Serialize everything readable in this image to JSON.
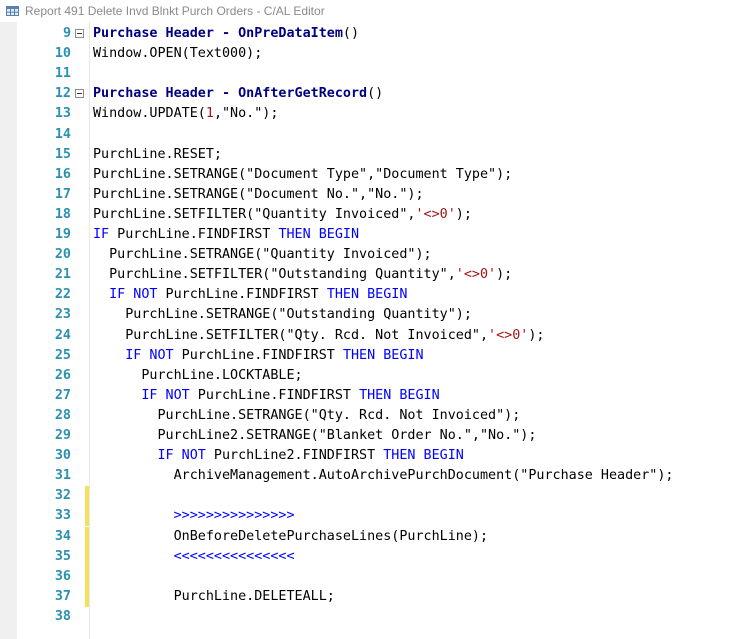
{
  "window": {
    "title": "Report 491 Delete Invd Blnkt Purch Orders - C/AL Editor",
    "icon": "table-grid-icon"
  },
  "editor": {
    "lines": [
      {
        "n": "9",
        "fold": true,
        "changed": false,
        "indent": 0,
        "tokens": [
          {
            "t": "Purchase Header - OnPreDataItem",
            "c": "navy bold"
          },
          {
            "t": "()",
            "c": ""
          }
        ]
      },
      {
        "n": "10",
        "fold": false,
        "changed": false,
        "indent": 0,
        "tokens": [
          {
            "t": "Window.OPEN(Text000);",
            "c": ""
          }
        ]
      },
      {
        "n": "11",
        "fold": false,
        "changed": false,
        "indent": 0,
        "tokens": []
      },
      {
        "n": "12",
        "fold": true,
        "changed": false,
        "indent": 0,
        "tokens": [
          {
            "t": "Purchase Header - OnAfterGetRecord",
            "c": "navy bold"
          },
          {
            "t": "()",
            "c": ""
          }
        ]
      },
      {
        "n": "13",
        "fold": false,
        "changed": false,
        "indent": 0,
        "tokens": [
          {
            "t": "Window.UPDATE(",
            "c": ""
          },
          {
            "t": "1",
            "c": "str"
          },
          {
            "t": ",\"No.\");",
            "c": ""
          }
        ]
      },
      {
        "n": "14",
        "fold": false,
        "changed": false,
        "indent": 0,
        "tokens": []
      },
      {
        "n": "15",
        "fold": false,
        "changed": false,
        "indent": 0,
        "tokens": [
          {
            "t": "PurchLine.RESET;",
            "c": ""
          }
        ]
      },
      {
        "n": "16",
        "fold": false,
        "changed": false,
        "indent": 0,
        "tokens": [
          {
            "t": "PurchLine.SETRANGE(\"Document Type\",\"Document Type\");",
            "c": ""
          }
        ]
      },
      {
        "n": "17",
        "fold": false,
        "changed": false,
        "indent": 0,
        "tokens": [
          {
            "t": "PurchLine.SETRANGE(\"Document No.\",\"No.\");",
            "c": ""
          }
        ]
      },
      {
        "n": "18",
        "fold": false,
        "changed": false,
        "indent": 0,
        "tokens": [
          {
            "t": "PurchLine.SETFILTER(\"Quantity Invoiced\",",
            "c": ""
          },
          {
            "t": "'<>0'",
            "c": "str"
          },
          {
            "t": ");",
            "c": ""
          }
        ]
      },
      {
        "n": "19",
        "fold": false,
        "changed": false,
        "indent": 0,
        "tokens": [
          {
            "t": "IF",
            "c": "kw"
          },
          {
            "t": " PurchLine.FINDFIRST ",
            "c": ""
          },
          {
            "t": "THEN BEGIN",
            "c": "kw"
          }
        ]
      },
      {
        "n": "20",
        "fold": false,
        "changed": false,
        "indent": 2,
        "tokens": [
          {
            "t": "PurchLine.SETRANGE(\"Quantity Invoiced\");",
            "c": ""
          }
        ]
      },
      {
        "n": "21",
        "fold": false,
        "changed": false,
        "indent": 2,
        "tokens": [
          {
            "t": "PurchLine.SETFILTER(\"Outstanding Quantity\",",
            "c": ""
          },
          {
            "t": "'<>0'",
            "c": "str"
          },
          {
            "t": ");",
            "c": ""
          }
        ]
      },
      {
        "n": "22",
        "fold": false,
        "changed": false,
        "indent": 2,
        "tokens": [
          {
            "t": "IF NOT",
            "c": "kw"
          },
          {
            "t": " PurchLine.FINDFIRST ",
            "c": ""
          },
          {
            "t": "THEN BEGIN",
            "c": "kw"
          }
        ]
      },
      {
        "n": "23",
        "fold": false,
        "changed": false,
        "indent": 4,
        "tokens": [
          {
            "t": "PurchLine.SETRANGE(\"Outstanding Quantity\");",
            "c": ""
          }
        ]
      },
      {
        "n": "24",
        "fold": false,
        "changed": false,
        "indent": 4,
        "tokens": [
          {
            "t": "PurchLine.SETFILTER(\"Qty. Rcd. Not Invoiced\",",
            "c": ""
          },
          {
            "t": "'<>0'",
            "c": "str"
          },
          {
            "t": ");",
            "c": ""
          }
        ]
      },
      {
        "n": "25",
        "fold": false,
        "changed": false,
        "indent": 4,
        "tokens": [
          {
            "t": "IF NOT",
            "c": "kw"
          },
          {
            "t": " PurchLine.FINDFIRST ",
            "c": ""
          },
          {
            "t": "THEN BEGIN",
            "c": "kw"
          }
        ]
      },
      {
        "n": "26",
        "fold": false,
        "changed": false,
        "indent": 6,
        "tokens": [
          {
            "t": "PurchLine.LOCKTABLE;",
            "c": ""
          }
        ]
      },
      {
        "n": "27",
        "fold": false,
        "changed": false,
        "indent": 6,
        "tokens": [
          {
            "t": "IF NOT",
            "c": "kw"
          },
          {
            "t": " PurchLine.FINDFIRST ",
            "c": ""
          },
          {
            "t": "THEN BEGIN",
            "c": "kw"
          }
        ]
      },
      {
        "n": "28",
        "fold": false,
        "changed": false,
        "indent": 8,
        "tokens": [
          {
            "t": "PurchLine.SETRANGE(\"Qty. Rcd. Not Invoiced\");",
            "c": ""
          }
        ]
      },
      {
        "n": "29",
        "fold": false,
        "changed": false,
        "indent": 8,
        "tokens": [
          {
            "t": "PurchLine2.SETRANGE(\"Blanket Order No.\",\"No.\");",
            "c": ""
          }
        ]
      },
      {
        "n": "30",
        "fold": false,
        "changed": false,
        "indent": 8,
        "tokens": [
          {
            "t": "IF NOT",
            "c": "kw"
          },
          {
            "t": " PurchLine2.FINDFIRST ",
            "c": ""
          },
          {
            "t": "THEN BEGIN",
            "c": "kw"
          }
        ]
      },
      {
        "n": "31",
        "fold": false,
        "changed": false,
        "indent": 10,
        "tokens": [
          {
            "t": "ArchiveManagement.AutoArchivePurchDocument(\"Purchase Header\");",
            "c": ""
          }
        ]
      },
      {
        "n": "32",
        "fold": false,
        "changed": true,
        "indent": 0,
        "tokens": []
      },
      {
        "n": "33",
        "fold": false,
        "changed": true,
        "indent": 10,
        "tokens": [
          {
            "t": ">>>>>>>>>>>>>>>",
            "c": "kw"
          }
        ]
      },
      {
        "n": "34",
        "fold": false,
        "changed": true,
        "indent": 10,
        "tokens": [
          {
            "t": "OnBeforeDeletePurchaseLines(PurchLine);",
            "c": ""
          }
        ]
      },
      {
        "n": "35",
        "fold": false,
        "changed": true,
        "indent": 10,
        "tokens": [
          {
            "t": "<<<<<<<<<<<<<<<",
            "c": "kw"
          }
        ]
      },
      {
        "n": "36",
        "fold": false,
        "changed": true,
        "indent": 0,
        "tokens": []
      },
      {
        "n": "37",
        "fold": false,
        "changed": true,
        "indent": 10,
        "tokens": [
          {
            "t": "PurchLine.DELETEALL;",
            "c": ""
          }
        ]
      },
      {
        "n": "38",
        "fold": false,
        "changed": false,
        "indent": 0,
        "tokens": []
      }
    ]
  }
}
